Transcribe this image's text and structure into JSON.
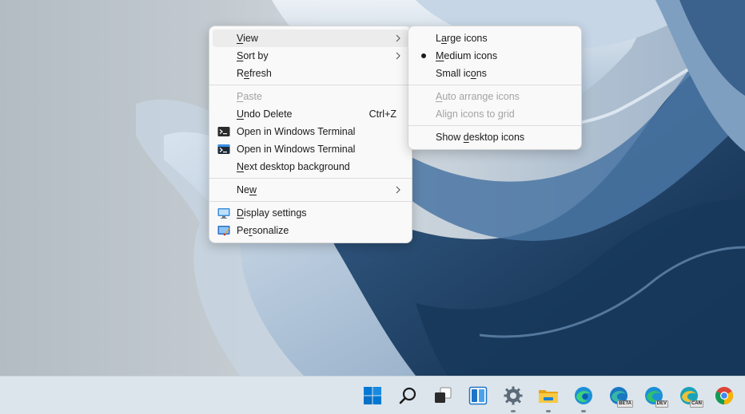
{
  "main_menu": {
    "view": {
      "pre": "",
      "ul": "V",
      "post": "iew"
    },
    "sort_by": {
      "pre": "",
      "ul": "S",
      "post": "ort by"
    },
    "refresh": {
      "pre": "R",
      "ul": "e",
      "post": "fresh"
    },
    "paste": {
      "pre": "",
      "ul": "P",
      "post": "aste"
    },
    "undo_delete": {
      "pre": "",
      "ul": "U",
      "post": "ndo Delete",
      "shortcut": "Ctrl+Z"
    },
    "open_terminal_1": "Open in Windows Terminal",
    "open_terminal_2": "Open in Windows Terminal",
    "next_background": {
      "pre": "",
      "ul": "N",
      "post": "ext desktop background"
    },
    "new": {
      "pre": "Ne",
      "ul": "w",
      "post": ""
    },
    "display_settings": {
      "pre": "",
      "ul": "D",
      "post": "isplay settings"
    },
    "personalize": {
      "pre": "Pe",
      "ul": "r",
      "post": "sonalize"
    }
  },
  "view_submenu": {
    "large_icons": {
      "pre": "L",
      "ul": "a",
      "post": "rge icons"
    },
    "medium_icons": {
      "pre": "",
      "ul": "M",
      "post": "edium icons",
      "selected": true
    },
    "small_icons": {
      "pre": "Small ic",
      "ul": "o",
      "post": "ns"
    },
    "auto_arrange": {
      "pre": "",
      "ul": "A",
      "post": "uto arrange icons"
    },
    "align_grid": {
      "pre": "Align icons to ",
      "ul": "g",
      "post": "rid"
    },
    "show_desktop_icons": {
      "pre": "Show ",
      "ul": "d",
      "post": "esktop icons"
    }
  },
  "taskbar": {
    "items": [
      "start",
      "search",
      "task-view",
      "widgets",
      "settings",
      "file-explorer",
      "edge",
      "edge-beta",
      "edge-dev",
      "edge-canary",
      "chrome"
    ],
    "badges": {
      "edge_beta": "BETA",
      "edge_dev": "DEV",
      "edge_canary": "CAN"
    }
  },
  "colors": {
    "accent": "#0067c0",
    "menu_bg": "#f9f9f9",
    "disabled_text": "#a3a3a3"
  }
}
